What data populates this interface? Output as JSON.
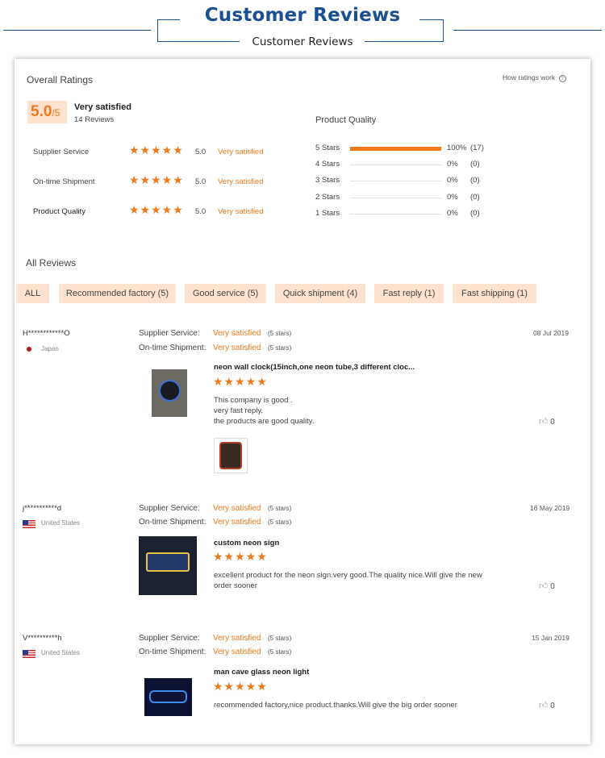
{
  "header": {
    "title": "Customer Reviews",
    "subtitle": "Customer Reviews"
  },
  "overall": {
    "heading": "Overall Ratings",
    "how_ratings_work": "How ratings work",
    "score": "5.0",
    "score_suffix": "/5",
    "label": "Very satisfied",
    "count": "14 Reviews",
    "categories": [
      {
        "name": "Supplier Service",
        "stars": "★★★★★",
        "score": "5.0",
        "label": "Very satisfied"
      },
      {
        "name": "On-time Shipment",
        "stars": "★★★★★",
        "score": "5.0",
        "label": "Very satisfied"
      },
      {
        "name": "Product Quality",
        "stars": "★★★★★",
        "score": "5.0",
        "label": "Very satisfied"
      }
    ]
  },
  "quality": {
    "heading": "Product Quality",
    "rows": [
      {
        "label": "5 Stars",
        "fraction": 1.0,
        "percent": "100%",
        "count": "(17)"
      },
      {
        "label": "4 Stars",
        "fraction": 0,
        "percent": "0%",
        "count": "(0)"
      },
      {
        "label": "3 Stars",
        "fraction": 0,
        "percent": "0%",
        "count": "(0)"
      },
      {
        "label": "2 Stars",
        "fraction": 0,
        "percent": "0%",
        "count": "(0)"
      },
      {
        "label": "1 Stars",
        "fraction": 0,
        "percent": "0%",
        "count": "(0)"
      }
    ]
  },
  "all_reviews": {
    "heading": "All Reviews",
    "filters": [
      "ALL",
      "Recommended factory (5)",
      "Good service (5)",
      "Quick shipment (4)",
      "Fast reply (1)",
      "Fast shipping (1)"
    ]
  },
  "reviews": [
    {
      "user": "H************O",
      "country": "Japan",
      "service_label": "Supplier Service:",
      "service_value": "Very satisfied",
      "service_stars": "(5 stars)",
      "shipment_label": "On-time Shipment:",
      "shipment_value": "Very satisfied",
      "shipment_stars": "(5 stars)",
      "date": "08 Jul 2019",
      "product": "neon wall clock(15inch,one neon tube,3 different cloc...",
      "stars": "★★★★★",
      "text": [
        "This company is good .",
        "very fast reply.",
        "the products are good quality."
      ],
      "likes": "0"
    },
    {
      "user": "j***********d",
      "country": "United States",
      "service_label": "Supplier Service:",
      "service_value": "Very satisfied",
      "service_stars": "(5 stars)",
      "shipment_label": "On-time Shipment:",
      "shipment_value": "Very satisfied",
      "shipment_stars": "(5 stars)",
      "date": "16 May 2019",
      "product": "custom neon sign",
      "stars": "★★★★★",
      "text": [
        "excellent product for the neon sign.very good.The quality nice.Will give the new",
        "order sooner"
      ],
      "likes": "0"
    },
    {
      "user": "V**********h",
      "country": "United States",
      "service_label": "Supplier Service:",
      "service_value": "Very satisfied",
      "service_stars": "(5 stars)",
      "shipment_label": "On-time Shipment:",
      "shipment_value": "Very satisfied",
      "shipment_stars": "(5 stars)",
      "date": "15 Jan 2019",
      "product": "man cave glass neon light",
      "stars": "★★★★★",
      "text": [
        "recommended factory,nice product.thanks.Will give the big order sooner"
      ],
      "likes": "0"
    }
  ]
}
